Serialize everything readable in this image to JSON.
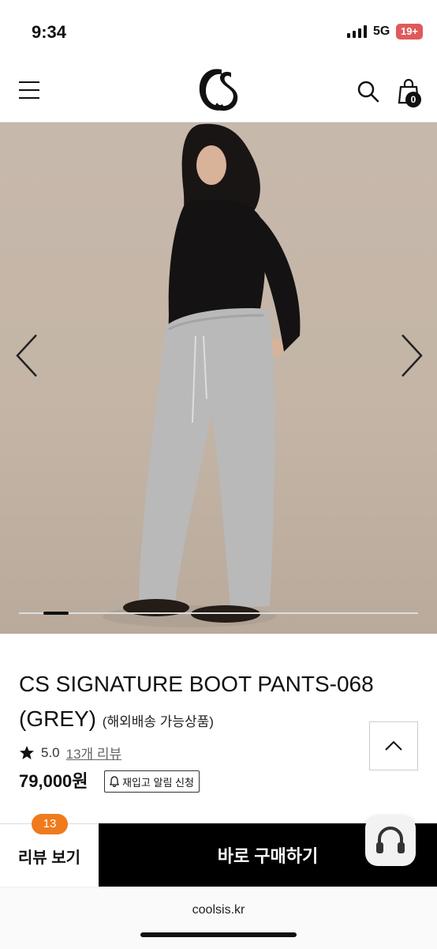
{
  "status_bar": {
    "time": "9:34",
    "network": "5G",
    "battery": "19+"
  },
  "header": {
    "menu_icon": "hamburger-menu-icon",
    "logo": "cs-logo",
    "search_icon": "search-icon",
    "cart_icon": "shopping-bag-icon",
    "cart_count": "0"
  },
  "gallery": {
    "prev_icon": "chevron-left-icon",
    "next_icon": "chevron-right-icon",
    "active_slide": 1
  },
  "product": {
    "title": "CS SIGNATURE BOOT PANTS-068",
    "title_line2": "(GREY)",
    "title_note": "(해외배송 가능상품)",
    "rating": "5.0",
    "reviews_link": "13개 리뷰",
    "price": "79,000원",
    "restock_button": "재입고 알림 신청"
  },
  "bottom_bar": {
    "review_count_badge": "13",
    "review_button": "리뷰 보기",
    "buy_button": "바로 구매하기"
  },
  "browser": {
    "url": "coolsis.kr"
  },
  "colors": {
    "badge": "#f07b1c",
    "buy_bg": "#000000",
    "battery": "#e05a5a"
  }
}
